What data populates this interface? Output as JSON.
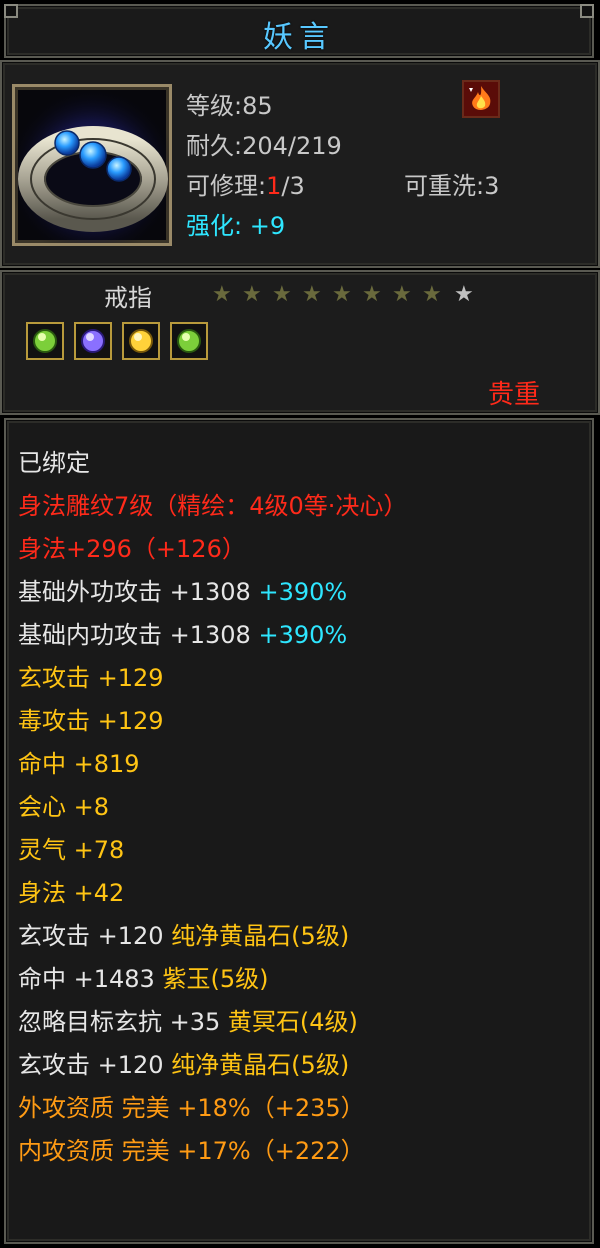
{
  "title": "妖言",
  "item": {
    "level": "等级:85",
    "durability": "耐久:204/219",
    "repair_label": "可修理:",
    "repair_used": "1",
    "repair_total": "/3",
    "rewash": "可重洗:3",
    "enhance_label": "强化:",
    "enhance_value": "+9",
    "type": "戒指",
    "stars_filled": 8,
    "stars_total": 9,
    "rarity": "贵重"
  },
  "colors": {
    "title": "#58c8ff",
    "white": "#e6e6e6",
    "red": "#ff2a1a",
    "gold": "#ffc414",
    "cyan": "#2ee6ff",
    "orange": "#ff9b14",
    "star_on": "#6a6a3c",
    "star_off": "#c0c0c0"
  },
  "gems": [
    {
      "icon": "green-gem-icon",
      "color": "#7ccf3a"
    },
    {
      "icon": "purple-gem-icon",
      "color": "#8a70ff"
    },
    {
      "icon": "yellow-gem-icon",
      "color": "#ffd23a"
    },
    {
      "icon": "green-gem-icon",
      "color": "#7ccf3a"
    }
  ],
  "properties": {
    "bound": "已绑定",
    "engraving": "身法雕纹7级（精绘：4级0等·决心）",
    "body_speed": "身法+296（+126）",
    "base_outer_atk": "基础外功攻击 +1308",
    "base_outer_atk_pct": "+390%",
    "base_inner_atk": "基础内功攻击 +1308",
    "base_inner_atk_pct": "+390%",
    "mystic_atk": "玄攻击 +129",
    "poison_atk": "毒攻击 +129",
    "accuracy": "命中 +819",
    "critical": "会心 +8",
    "spirit": "灵气 +78",
    "agility": "身法 +42",
    "gem1_stat": "玄攻击 +120",
    "gem1_name": "纯净黄晶石(5级)",
    "gem2_stat": "命中 +1483",
    "gem2_name": "紫玉(5级)",
    "gem3_stat": "忽略目标玄抗 +35",
    "gem3_name": "黄冥石(4级)",
    "gem4_stat": "玄攻击 +120",
    "gem4_name": "纯净黄晶石(5级)",
    "outer_quality": "外攻资质  完美 +18%（+235）",
    "inner_quality": "内攻资质  完美 +17%（+222）"
  }
}
